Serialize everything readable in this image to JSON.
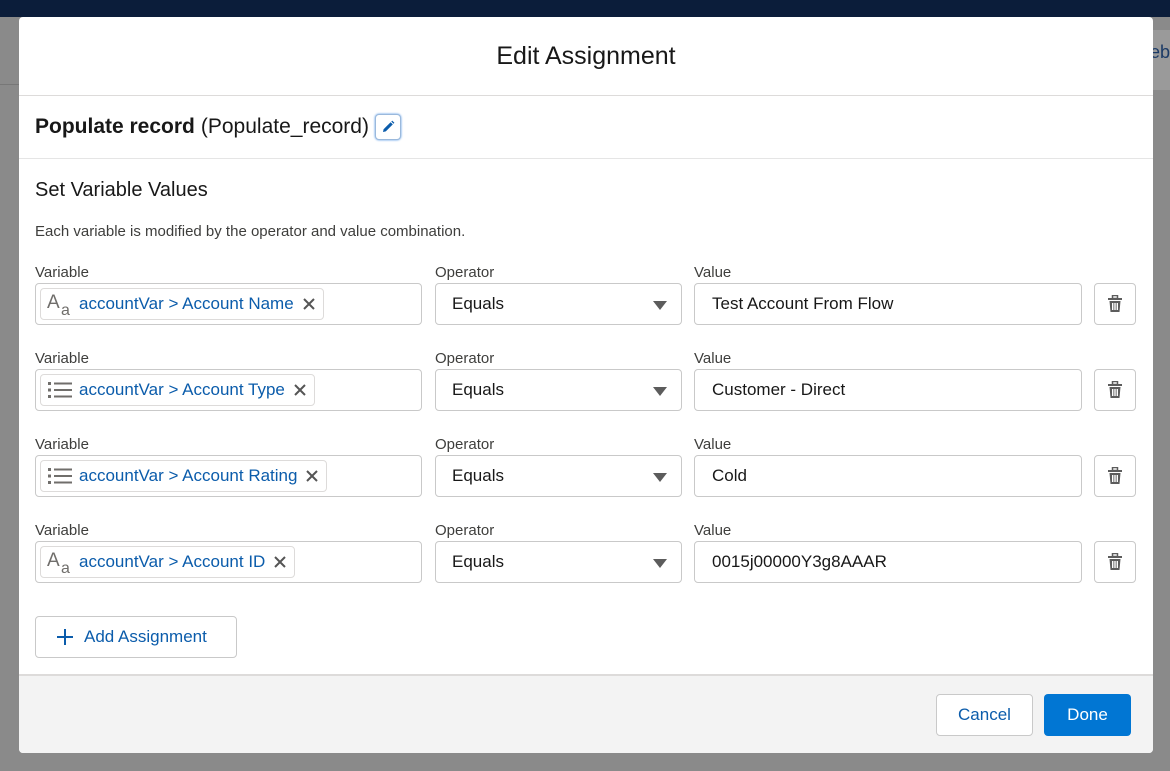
{
  "modal": {
    "title": "Edit Assignment",
    "element": {
      "label": "Populate record",
      "api_name": "(Populate_record)"
    },
    "section_title": "Set Variable Values",
    "section_description": "Each variable is modified by the operator and value combination."
  },
  "labels": {
    "variable": "Variable",
    "operator": "Operator",
    "value": "Value"
  },
  "assignments": [
    {
      "variable": "accountVar > Account Name",
      "icon": "text-type-icon",
      "operator": "Equals",
      "value": "Test Account From Flow"
    },
    {
      "variable": "accountVar > Account Type",
      "icon": "picklist-icon",
      "operator": "Equals",
      "value": "Customer - Direct"
    },
    {
      "variable": "accountVar > Account Rating",
      "icon": "picklist-icon",
      "operator": "Equals",
      "value": "Cold"
    },
    {
      "variable": "accountVar > Account ID",
      "icon": "text-type-icon",
      "operator": "Equals",
      "value": "0015j00000Y3g8AAAR"
    }
  ],
  "add_assignment_label": "Add Assignment",
  "footer": {
    "cancel_label": "Cancel",
    "done_label": "Done"
  },
  "background": {
    "edge_text": "eb"
  },
  "colors": {
    "brand": "#0176d3",
    "link": "#0b5cab",
    "header_bar": "#0b1d3a"
  }
}
